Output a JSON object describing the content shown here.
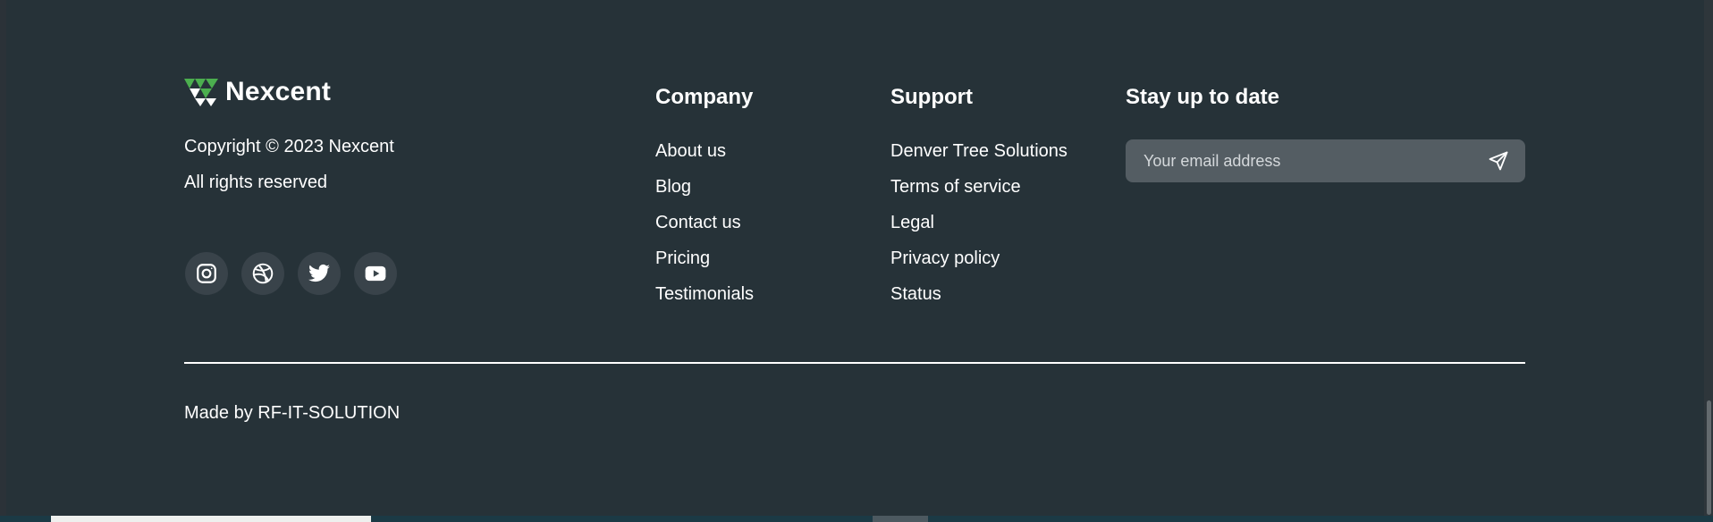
{
  "brand": {
    "name": "Nexcent",
    "logo_icon": "nexcent-logo-icon",
    "accent_color": "#4CAF4F"
  },
  "copyright": {
    "line1": "Copyright © 2023 Nexcent",
    "line2": "All rights reserved"
  },
  "socials": [
    {
      "icon": "instagram-icon"
    },
    {
      "icon": "dribbble-icon"
    },
    {
      "icon": "twitter-icon"
    },
    {
      "icon": "youtube-icon"
    }
  ],
  "company": {
    "title": "Company",
    "links": [
      "About us",
      "Blog",
      "Contact us",
      "Pricing",
      "Testimonials"
    ]
  },
  "support": {
    "title": "Support",
    "links": [
      "Denver Tree Solutions",
      "Terms of service",
      "Legal",
      "Privacy policy",
      "Status"
    ]
  },
  "newsletter": {
    "title": "Stay up to date",
    "placeholder": "Your email address",
    "send_icon": "send-icon"
  },
  "footer_bottom": {
    "made_by": "Made by RF-IT-SOLUTION"
  },
  "colors": {
    "background": "#263238",
    "social_bg": "#39434A",
    "input_bg": "#545D63",
    "text": "#FFFFFF"
  }
}
